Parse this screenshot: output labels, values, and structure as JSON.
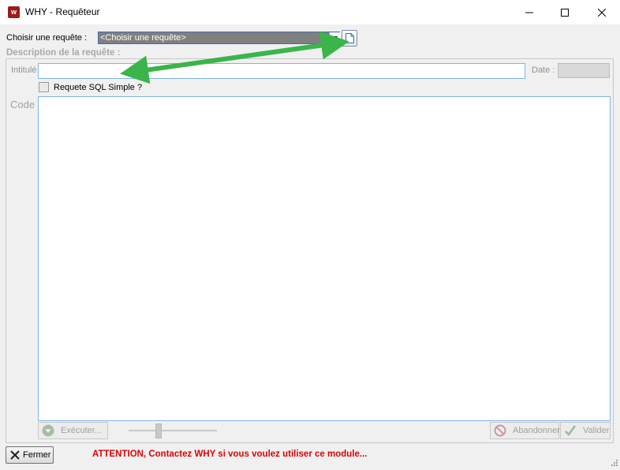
{
  "window": {
    "title": "WHY - Requêteur",
    "app_icon_text": "w"
  },
  "query_selector": {
    "label": "Choisir une requête :",
    "selected": "<Choisir une requête>"
  },
  "description": {
    "heading": "Description de la requête :",
    "intitule_label": "Intitulé",
    "intitule_value": "",
    "date_label": "Date :",
    "date_value": "",
    "sql_checkbox_label": "Requete SQL Simple ?",
    "sql_checked": false,
    "code_label": "Code",
    "code_value": ""
  },
  "toolbar": {
    "execute_label": "Exécuter...",
    "abandon_label": "Abandonner",
    "validate_label": "Valider"
  },
  "footer": {
    "close_label": "Fermer",
    "warning": "ATTENTION, Contactez WHY si vous voulez utiliser ce module..."
  },
  "colors": {
    "accent": "#9c1b1b",
    "warning": "#e00000",
    "arrow": "#3ab54a",
    "focus_border": "#7eb4ea"
  }
}
